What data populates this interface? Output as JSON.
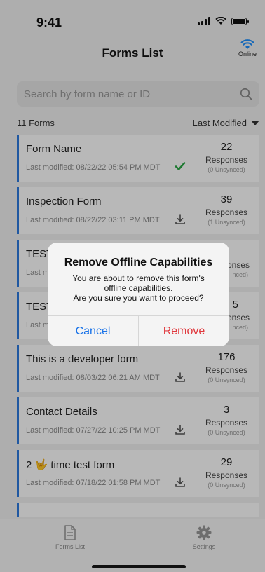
{
  "status_bar": {
    "time": "9:41"
  },
  "header": {
    "title": "Forms List",
    "online_label": "Online"
  },
  "search": {
    "placeholder": "Search by form name or ID"
  },
  "list_meta": {
    "count_label": "11 Forms",
    "sort_label": "Last Modified"
  },
  "forms": [
    {
      "name": "Form Name",
      "modified": "Last modified: 08/22/22 05:54 PM MDT",
      "status_icon": "checkmark-icon",
      "count": "22",
      "responses_label": "Responses",
      "unsynced": "(0 Unsynced)"
    },
    {
      "name": "Inspection Form",
      "modified": "Last modified: 08/22/22 03:11 PM MDT",
      "status_icon": "download-icon",
      "count": "39",
      "responses_label": "Responses",
      "unsynced": "(1 Unsynced)"
    },
    {
      "name": "TEST",
      "modified": "Last m",
      "status_icon": "",
      "count": "",
      "responses_label": "onses",
      "unsynced": "nced)"
    },
    {
      "name": "TEST",
      "modified": "Last m",
      "status_icon": "",
      "count": "5",
      "responses_label": "onses",
      "unsynced": "nced)"
    },
    {
      "name": "This is a developer form",
      "modified": "Last modified: 08/03/22 06:21 AM MDT",
      "status_icon": "download-icon",
      "count": "176",
      "responses_label": "Responses",
      "unsynced": "(0 Unsynced)"
    },
    {
      "name": "Contact Details",
      "modified": "Last modified: 07/27/22 10:25 PM MDT",
      "status_icon": "download-icon",
      "count": "3",
      "responses_label": "Responses",
      "unsynced": "(0 Unsynced)"
    },
    {
      "name": "2 🤟 time test form",
      "modified": "Last modified: 07/18/22 01:58 PM MDT",
      "status_icon": "download-icon",
      "count": "29",
      "responses_label": "Responses",
      "unsynced": "(0 Unsynced)"
    }
  ],
  "alert": {
    "title": "Remove Offline Capabilities",
    "message_line1": "You are about to remove this form's",
    "message_line2": "offline capabilities.",
    "message_line3": "Are you sure you want to proceed?",
    "cancel_label": "Cancel",
    "remove_label": "Remove"
  },
  "tabbar": {
    "forms_label": "Forms List",
    "settings_label": "Settings"
  },
  "colors": {
    "accent": "#2d7be0",
    "online": "#1e90ff",
    "destructive": "#e0393e",
    "success": "#2aa845"
  }
}
